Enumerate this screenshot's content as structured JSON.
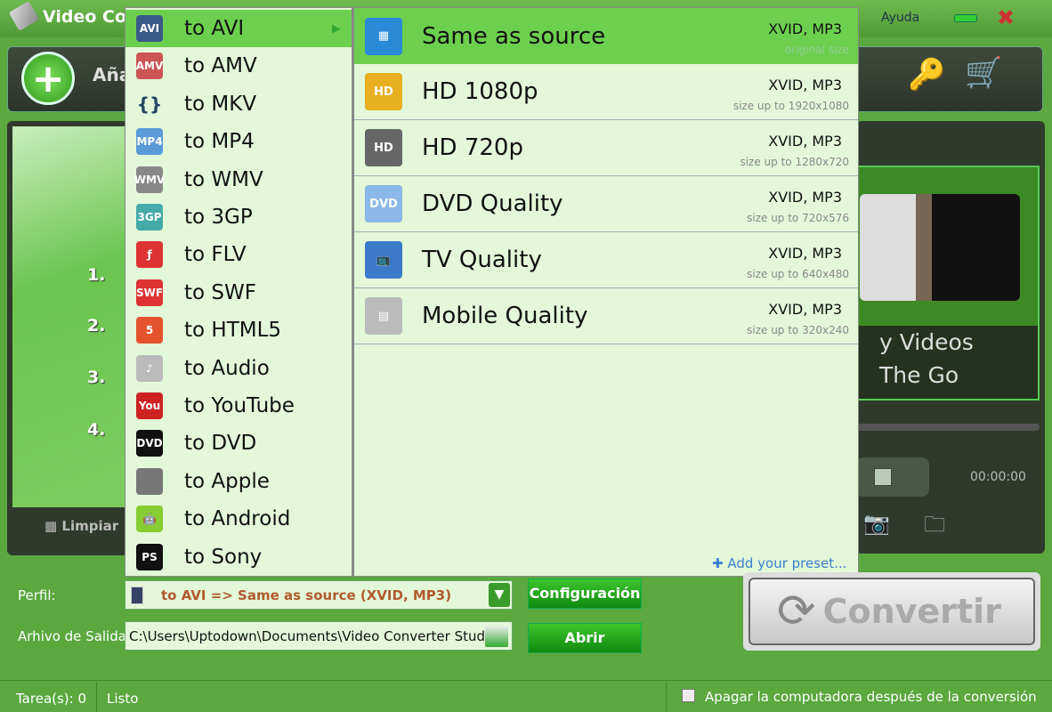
{
  "window": {
    "title": "Video Co",
    "help": "Ayuda"
  },
  "toolbar": {
    "add_label": "Aña"
  },
  "left_panel": {
    "steps": [
      "1. ",
      "2. ",
      "3. ",
      "4. "
    ],
    "clear_label": "Limpiar"
  },
  "format_menu": [
    {
      "label": "to AVI",
      "icon": "avi-file-icon",
      "selected": true
    },
    {
      "label": "to AMV",
      "icon": "amv-file-icon"
    },
    {
      "label": "to MKV",
      "icon": "mkv-icon"
    },
    {
      "label": "to MP4",
      "icon": "mp4-file-icon"
    },
    {
      "label": "to WMV",
      "icon": "wmv-file-icon"
    },
    {
      "label": "to 3GP",
      "icon": "3gp-file-icon"
    },
    {
      "label": "to FLV",
      "icon": "flash-icon"
    },
    {
      "label": "to SWF",
      "icon": "swf-icon"
    },
    {
      "label": "to HTML5",
      "icon": "html5-icon"
    },
    {
      "label": "to Audio",
      "icon": "audio-note-icon"
    },
    {
      "label": "to YouTube",
      "icon": "youtube-icon"
    },
    {
      "label": "to DVD",
      "icon": "dvd-logo-icon"
    },
    {
      "label": "to Apple",
      "icon": "apple-icon"
    },
    {
      "label": "to Android",
      "icon": "android-icon"
    },
    {
      "label": "to Sony",
      "icon": "playstation-icon"
    }
  ],
  "preset_menu": [
    {
      "label": "Same as source",
      "codec": "XVID, MP3",
      "size": "original size",
      "icon": "film-icon",
      "selected": true
    },
    {
      "label": "HD 1080p",
      "codec": "XVID, MP3",
      "size": "size up to 1920x1080",
      "icon": "hd-1080-icon"
    },
    {
      "label": "HD 720p",
      "codec": "XVID, MP3",
      "size": "size up to 1280x720",
      "icon": "hd-720-icon"
    },
    {
      "label": "DVD Quality",
      "codec": "XVID, MP3",
      "size": "size up to 720x576",
      "icon": "dvd-disc-icon"
    },
    {
      "label": "TV Quality",
      "codec": "XVID, MP3",
      "size": "size up to 640x480",
      "icon": "tv-icon"
    },
    {
      "label": "Mobile Quality",
      "codec": "XVID, MP3",
      "size": "size up to 320x240",
      "icon": "mobile-phone-icon"
    }
  ],
  "add_preset": "Add your preset...",
  "preview": {
    "promo_line1": "y Videos",
    "promo_line2": "The Go",
    "time": "00:00:00"
  },
  "profile": {
    "label": "Perfil:",
    "value": "to AVI => Same as source (XVID, MP3)",
    "settings_button": "Configuración"
  },
  "output": {
    "label": "Arhivo de Salida:",
    "value": "C:\\Users\\Uptodown\\Documents\\Video Converter Studio",
    "open_button": "Abrir"
  },
  "convert_button": "Convertir",
  "status": {
    "tasks": "Tarea(s): 0",
    "state": "Listo",
    "shutdown_label": "Apagar la computadora después de la conversión",
    "shutdown_checked": false
  },
  "colors": {
    "window_bg": "#5aa83e",
    "menu_bg": "#e3f8d8",
    "menu_selected": "#6cd04e",
    "profile_text": "#b05a2e"
  }
}
